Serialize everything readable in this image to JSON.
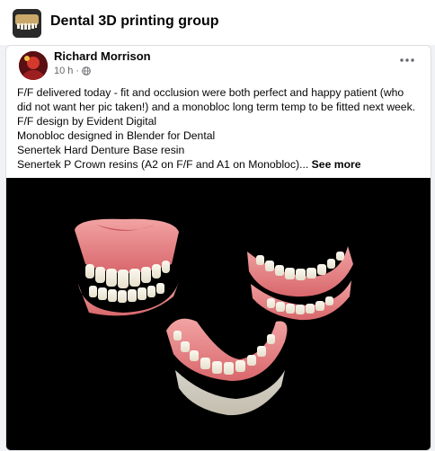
{
  "group": {
    "name": "Dental 3D printing group",
    "icon": "group-photo-icon"
  },
  "post": {
    "author": "Richard Morrison",
    "time": "10 h",
    "separator": "·",
    "audience_icon": "globe-icon",
    "menu_icon": "more-options-icon",
    "text_lines": [
      "F/F delivered today - fit and occlusion were both perfect and happy patient (who",
      "did not want her pic taken!) and a monobloc long term temp to be fitted next week.",
      "F/F design by Evident Digital",
      "Monobloc designed in Blender for Dental",
      "Senertek Hard Denture Base resin"
    ],
    "last_line": "Senertek P Crown resins (A2 on F/F and A1 on Monobloc)...",
    "see_more": "See more"
  },
  "colors": {
    "gum_pink": "#e8868a",
    "tooth_white": "#f3efe4",
    "photo_bg": "#000000",
    "meta_gray": "#65676b"
  }
}
